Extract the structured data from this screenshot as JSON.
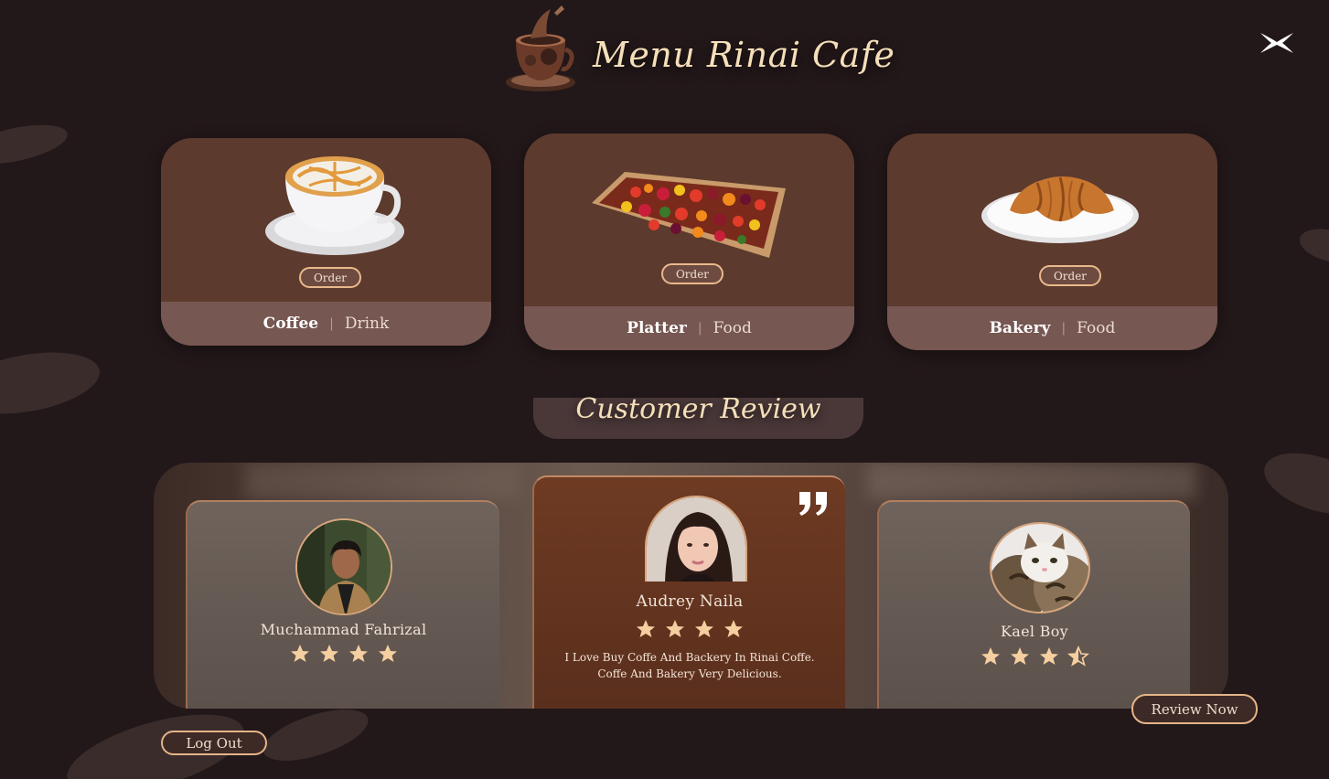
{
  "header": {
    "title": "Menu Rinai Cafe",
    "logo_icon": "coffee-cup-logo-icon",
    "close_icon": "close-x-icon"
  },
  "menu": [
    {
      "name": "Coffee",
      "category": "Drink",
      "order_label": "Order",
      "image": "latte-cup-image"
    },
    {
      "name": "Platter",
      "category": "Food",
      "order_label": "Order",
      "image": "fruit-platter-image"
    },
    {
      "name": "Bakery",
      "category": "Food",
      "order_label": "Order",
      "image": "croissant-image"
    }
  ],
  "reviews_section": {
    "title": "Customer Review",
    "reviews": [
      {
        "name": "Muchammad Fahrizal",
        "rating": 4,
        "text": ""
      },
      {
        "name": "Audrey Naila",
        "rating": 4,
        "text_line1": "I Love Buy Coffe And Backery In Rinai Coffe.",
        "text_line2": "Coffe And Bakery Very Delicious."
      },
      {
        "name": "Kael Boy",
        "rating": 3.5,
        "text": ""
      }
    ],
    "quote_icon": "quote-mark-icon"
  },
  "buttons": {
    "review_now": "Review Now",
    "log_out": "Log Out"
  },
  "colors": {
    "background": "#221719",
    "card": "#5d3a2e",
    "card_footer": "#765751",
    "accent_gold": "#e9b98b",
    "title": "#f5dfb9"
  }
}
